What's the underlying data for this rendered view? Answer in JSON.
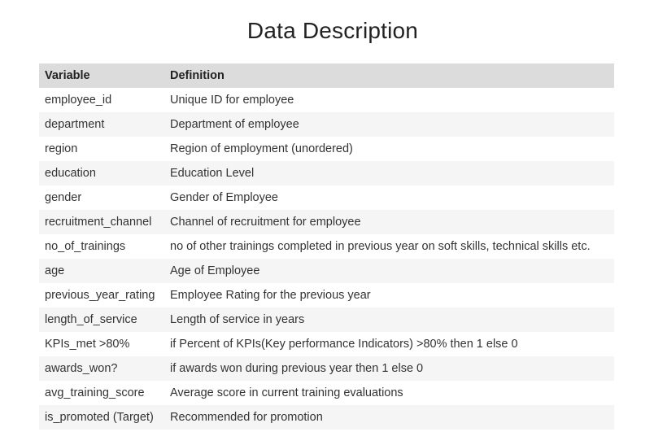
{
  "title": "Data Description",
  "table": {
    "headers": [
      "Variable",
      "Definition"
    ],
    "rows": [
      [
        "employee_id",
        "Unique ID for employee"
      ],
      [
        "department",
        "Department of employee"
      ],
      [
        "region",
        "Region of employment (unordered)"
      ],
      [
        "education",
        "Education Level"
      ],
      [
        "gender",
        "Gender of Employee"
      ],
      [
        "recruitment_channel",
        "Channel of recruitment for employee"
      ],
      [
        "no_of_trainings",
        "no of other trainings completed in previous year on soft skills, technical skills etc."
      ],
      [
        "age",
        "Age of Employee"
      ],
      [
        "previous_year_rating",
        "Employee Rating for the previous year"
      ],
      [
        "length_of_service",
        "Length of service in years"
      ],
      [
        "KPIs_met >80%",
        "if Percent of KPIs(Key performance Indicators) >80% then 1 else 0"
      ],
      [
        "awards_won?",
        "if awards won during previous year then 1 else 0"
      ],
      [
        "avg_training_score",
        "Average score in current training evaluations"
      ],
      [
        "is_promoted (Target)",
        "Recommended for promotion"
      ]
    ]
  }
}
